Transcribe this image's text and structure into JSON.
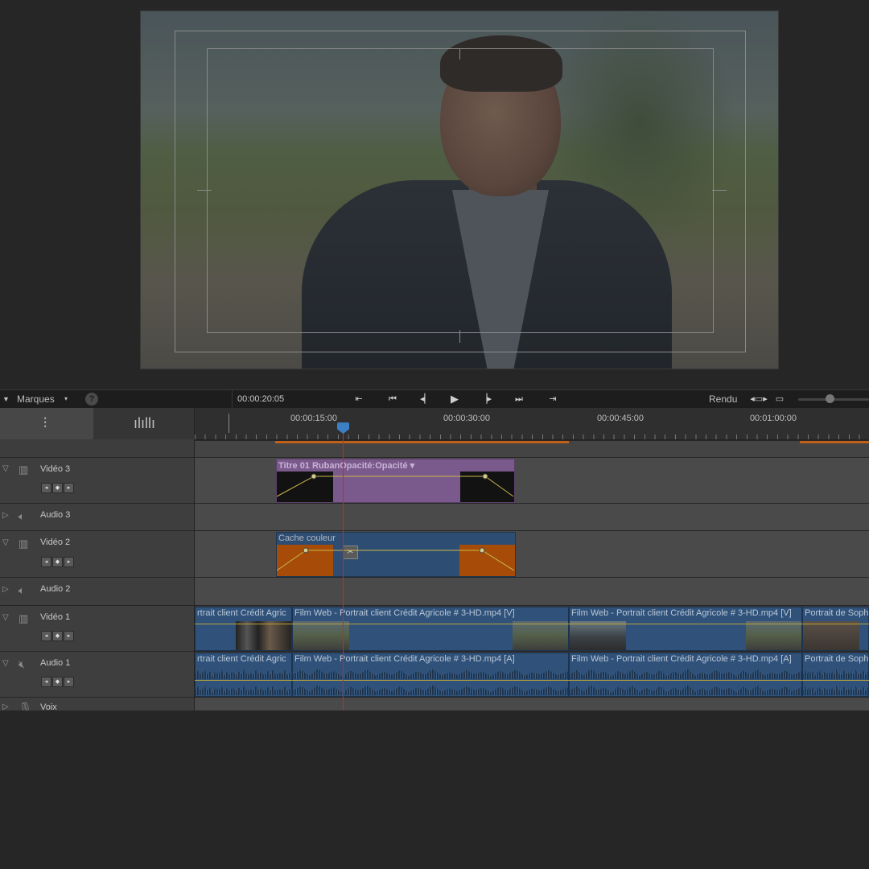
{
  "toolbar": {
    "markers_label": "Marques",
    "help_symbol": "?",
    "timecode": "00:00:20:05",
    "render_label": "Rendu",
    "transport_icons": [
      "go-to-start-marker-icon",
      "previous-edit-icon",
      "step-back-icon",
      "play-icon",
      "step-forward-icon",
      "next-edit-icon",
      "go-to-end-marker-icon"
    ]
  },
  "ruler": {
    "labels": [
      "00:00:15:00",
      "00:00:30:00",
      "00:00:45:00",
      "00:01:00:00"
    ]
  },
  "tracks": [
    {
      "name": "Vidéo 3",
      "type": "video",
      "expanded": true
    },
    {
      "name": "Audio 3",
      "type": "audio",
      "expanded": false
    },
    {
      "name": "Vidéo 2",
      "type": "video",
      "expanded": true
    },
    {
      "name": "Audio 2",
      "type": "audio",
      "expanded": false
    },
    {
      "name": "Vidéo 1",
      "type": "video",
      "expanded": true
    },
    {
      "name": "Audio 1",
      "type": "audio",
      "expanded": true
    },
    {
      "name": "Voix",
      "type": "audio",
      "expanded": false
    }
  ],
  "clips": {
    "title": "Titre 01 RubanOpacité:Opacité ▾",
    "matte": "Cache couleur",
    "v1": [
      "rtrait client Crédit Agric",
      "Film Web - Portrait client Crédit Agricole # 3-HD.mp4 [V]",
      "Film Web - Portrait client Crédit Agricole # 3-HD.mp4 [V]",
      "Portrait de Soph"
    ],
    "a1": [
      "rtrait client Crédit Agric",
      "Film Web - Portrait client Crédit Agricole # 3-HD.mp4 [A]",
      "Film Web - Portrait client Crédit Agricole # 3-HD.mp4 [A]",
      "Portrait de Soph"
    ]
  },
  "colors": {
    "title_clip": "#7a5a8c",
    "media_clip": "#30527a",
    "keyframe_area": "#a64c08",
    "playhead": "#c8282a",
    "work_area": "#c0611a"
  }
}
